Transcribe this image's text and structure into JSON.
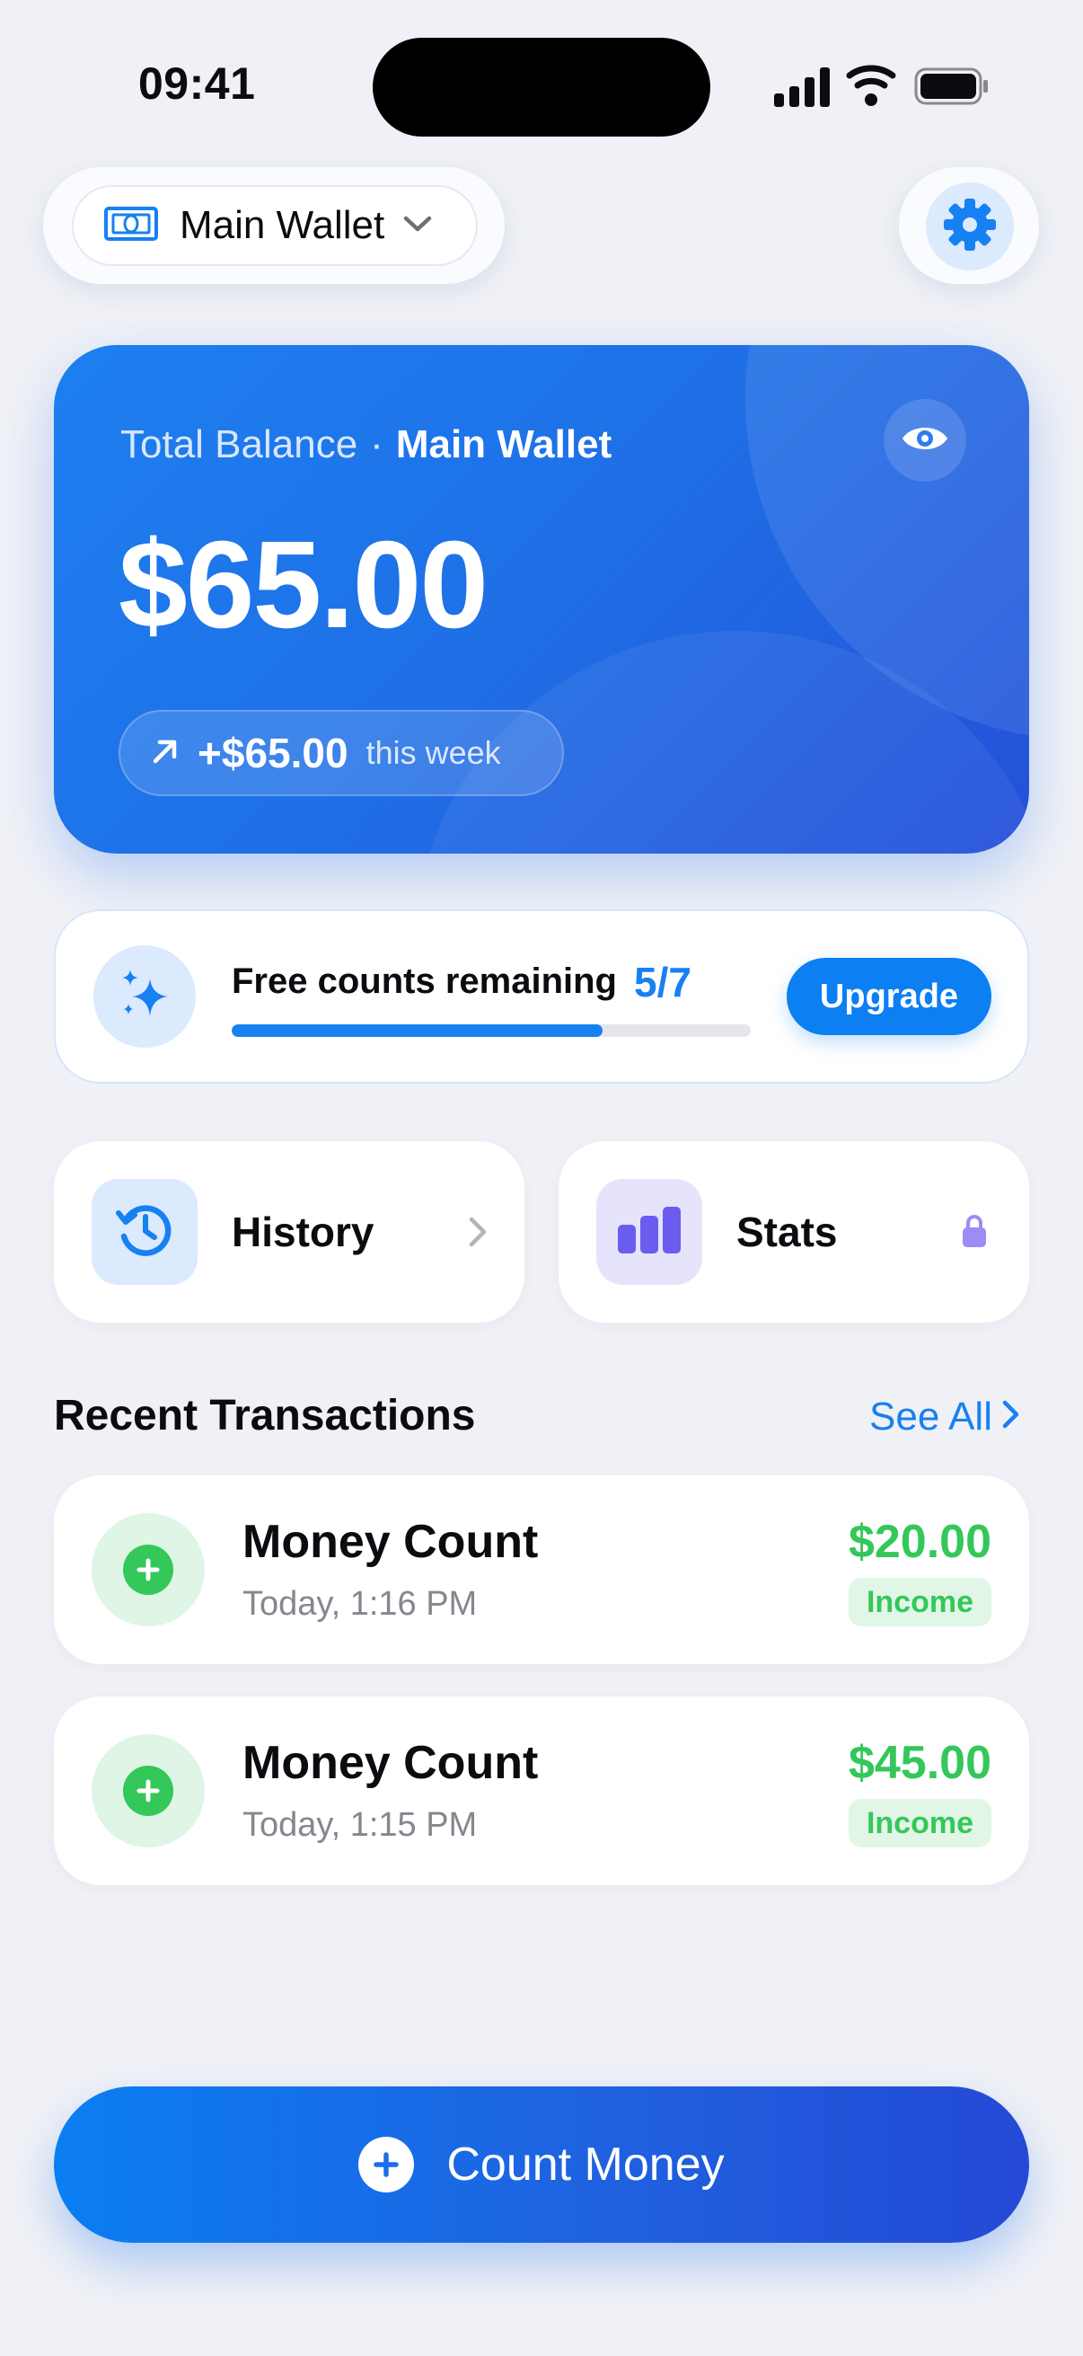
{
  "status_bar": {
    "time": "09:41",
    "icons": [
      "signal-icon",
      "wifi-icon",
      "battery-icon"
    ]
  },
  "header": {
    "wallet_selector": {
      "label": "Main Wallet",
      "icon": "wallet-icon"
    },
    "settings_icon": "gear-icon"
  },
  "balance_card": {
    "title": "Total Balance",
    "separator": "·",
    "wallet_name": "Main Wallet",
    "amount": "$65.00",
    "weekly_change": {
      "amount": "+$65.00",
      "label": "this week",
      "icon": "arrow-up-right-icon"
    },
    "visibility_icon": "eye-icon"
  },
  "free_counts": {
    "label": "Free counts remaining",
    "count": "5/7",
    "progress": 0.714,
    "upgrade_label": "Upgrade",
    "icon": "sparkles-icon"
  },
  "quick_actions": [
    {
      "label": "History",
      "icon": "clock-history-icon",
      "accessory": "chevron-right-icon"
    },
    {
      "label": "Stats",
      "icon": "bar-chart-icon",
      "accessory": "lock-icon"
    }
  ],
  "recent": {
    "title": "Recent Transactions",
    "see_all": "See All"
  },
  "transactions": [
    {
      "title": "Money Count",
      "date": "Today, 1:16 PM",
      "amount": "$20.00",
      "type": "Income"
    },
    {
      "title": "Money Count",
      "date": "Today, 1:15 PM",
      "amount": "$45.00",
      "type": "Income"
    }
  ],
  "cta": {
    "label": "Count Money",
    "icon": "plus-circle-icon"
  },
  "colors": {
    "accent": "#1780f2",
    "income": "#34c759",
    "stats": "#6b5cf0",
    "background": "#f0f1f6"
  }
}
